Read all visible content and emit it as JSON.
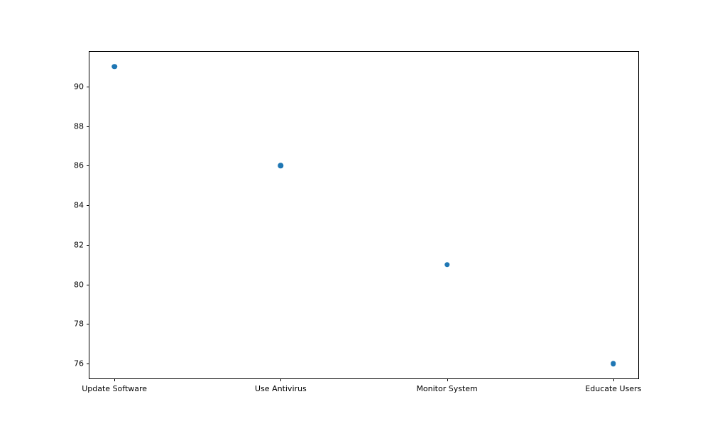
{
  "chart_data": {
    "type": "scatter",
    "categories": [
      "Update Software",
      "Use Antivirus",
      "Monitor System",
      "Educate Users"
    ],
    "values": [
      90,
      85,
      80,
      75
    ],
    "title": "",
    "xlabel": "",
    "ylabel": "",
    "ylim": [
      74.25,
      90.75
    ],
    "y_ticks": [
      76,
      78,
      80,
      82,
      84,
      86,
      88,
      90
    ],
    "point_color": "#1f77b4"
  }
}
